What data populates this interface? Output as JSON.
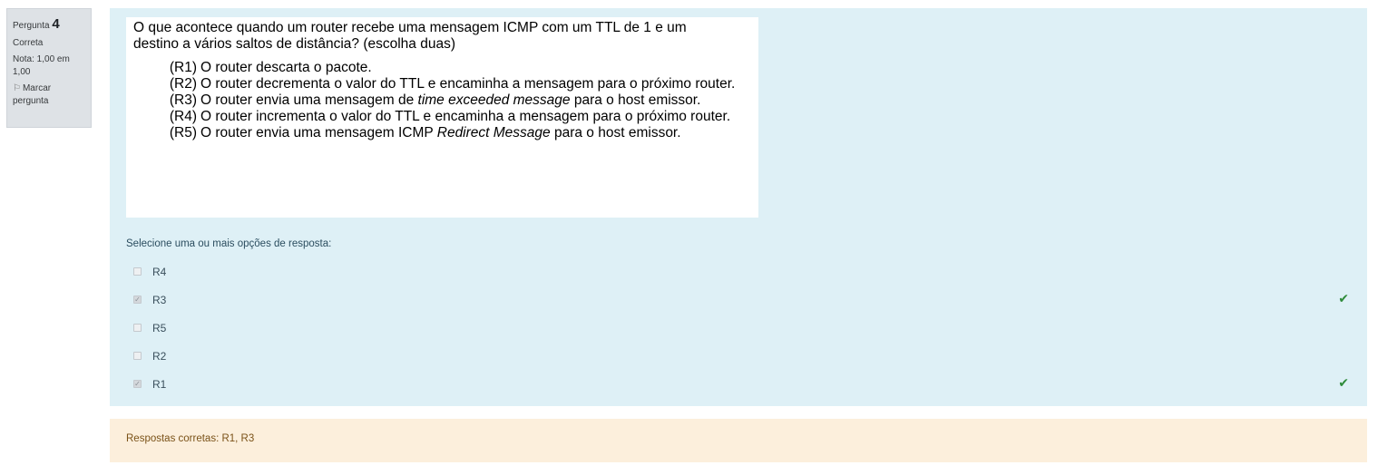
{
  "info": {
    "question_label": "Pergunta",
    "question_number": "4",
    "state": "Correta",
    "grade": "Nota: 1,00 em 1,00",
    "flag_label": "Marcar pergunta"
  },
  "question": {
    "stem_line1": "O que acontece quando um router recebe uma mensagem ICMP com um TTL de 1 e um",
    "stem_line2": "destino a vários saltos de distância? (escolha duas)",
    "options": [
      {
        "tag": "(R1)",
        "text_before": "O router descarta o pacote.",
        "italic": "",
        "text_after": ""
      },
      {
        "tag": "(R2)",
        "text_before": "O router decrementa o valor do TTL e encaminha a mensagem para o próximo router.",
        "italic": "",
        "text_after": ""
      },
      {
        "tag": "(R3)",
        "text_before": "O router envia uma mensagem de ",
        "italic": "time exceeded message",
        "text_after": " para o host emissor."
      },
      {
        "tag": "(R4)",
        "text_before": "O router incrementa o valor do TTL e encaminha a mensagem para o próximo router.",
        "italic": "",
        "text_after": ""
      },
      {
        "tag": "(R5)",
        "text_before": "O router envia uma mensagem ICMP ",
        "italic": "Redirect Message",
        "text_after": " para o host emissor."
      }
    ]
  },
  "prompt": "Selecione uma ou mais opções de resposta:",
  "answers": [
    {
      "label": "R4",
      "checked": false,
      "correct_mark": false
    },
    {
      "label": "R3",
      "checked": true,
      "correct_mark": true
    },
    {
      "label": "R5",
      "checked": false,
      "correct_mark": false
    },
    {
      "label": "R2",
      "checked": false,
      "correct_mark": false
    },
    {
      "label": "R1",
      "checked": true,
      "correct_mark": true
    }
  ],
  "icons": {
    "flag": "flag-icon",
    "check": "check-icon"
  },
  "colors": {
    "formulation_bg": "#def0f6",
    "outcome_bg": "#fcefdc",
    "check_green": "#2e8b3a"
  },
  "feedback": {
    "right_answer": "Respostas corretas: R1, R3"
  }
}
